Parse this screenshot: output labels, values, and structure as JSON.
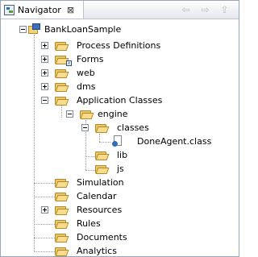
{
  "view": {
    "tab_label": "Navigator",
    "close_glyph": "⊠",
    "toolbar": [
      {
        "name": "back-arrow-icon",
        "glyph": "⇦"
      },
      {
        "name": "forward-arrow-icon",
        "glyph": "⇨"
      },
      {
        "name": "go-up-icon",
        "glyph": "⇧"
      }
    ]
  },
  "tree": {
    "project": "BankLoanSample",
    "items": {
      "process_definitions": "Process Definitions",
      "forms": "Forms",
      "web": "web",
      "dms": "dms",
      "application_classes": "Application Classes",
      "engine": "engine",
      "classes": "classes",
      "done_agent": "DoneAgent.class",
      "lib": "lib",
      "js": "js",
      "simulation": "Simulation",
      "calendar": "Calendar",
      "resources": "Resources",
      "rules": "Rules",
      "documents": "Documents",
      "analytics": "Analytics"
    }
  }
}
